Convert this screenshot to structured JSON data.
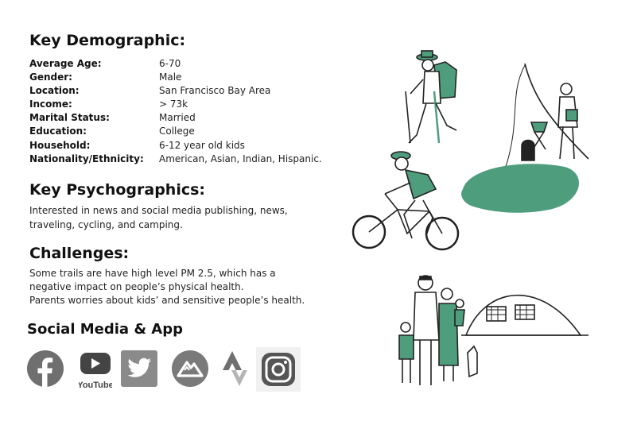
{
  "demographic": {
    "heading": "Key Demographic:",
    "rows": [
      {
        "label": "Average Age:",
        "value": "6-70"
      },
      {
        "label": "Gender:",
        "value": "Male"
      },
      {
        "label": "Location:",
        "value": "San Francisco Bay Area"
      },
      {
        "label": "Income:",
        "value": "> 73k"
      },
      {
        "label": "Marital Status:",
        "value": "Married"
      },
      {
        "label": "Education:",
        "value": "College"
      },
      {
        "label": "Household:",
        "value": "6-12 year old kids"
      },
      {
        "label": "Nationality/Ethnicity:",
        "value": "American, Asian, Indian, Hispanic."
      }
    ]
  },
  "psychographics": {
    "heading": "Key Psychographics:",
    "text": "Interested in news and social media publishing, news, traveling, cycling, and camping."
  },
  "challenges": {
    "heading": "Challenges:",
    "lines": [
      "Some trails are have high level PM 2.5, which has a negative impact on people’s physical health.",
      "Parents worries about kids’ and sensitive people’s health."
    ]
  },
  "social": {
    "heading": "Social Media & App",
    "youtube_text": "YouTube",
    "icons": [
      "facebook-icon",
      "youtube-icon",
      "twitter-icon",
      "alltrails-icon",
      "strava-icon",
      "instagram-icon"
    ]
  },
  "colors": {
    "accent_green": "#4e9e7e",
    "icon_gray": "#6f6f6f"
  }
}
